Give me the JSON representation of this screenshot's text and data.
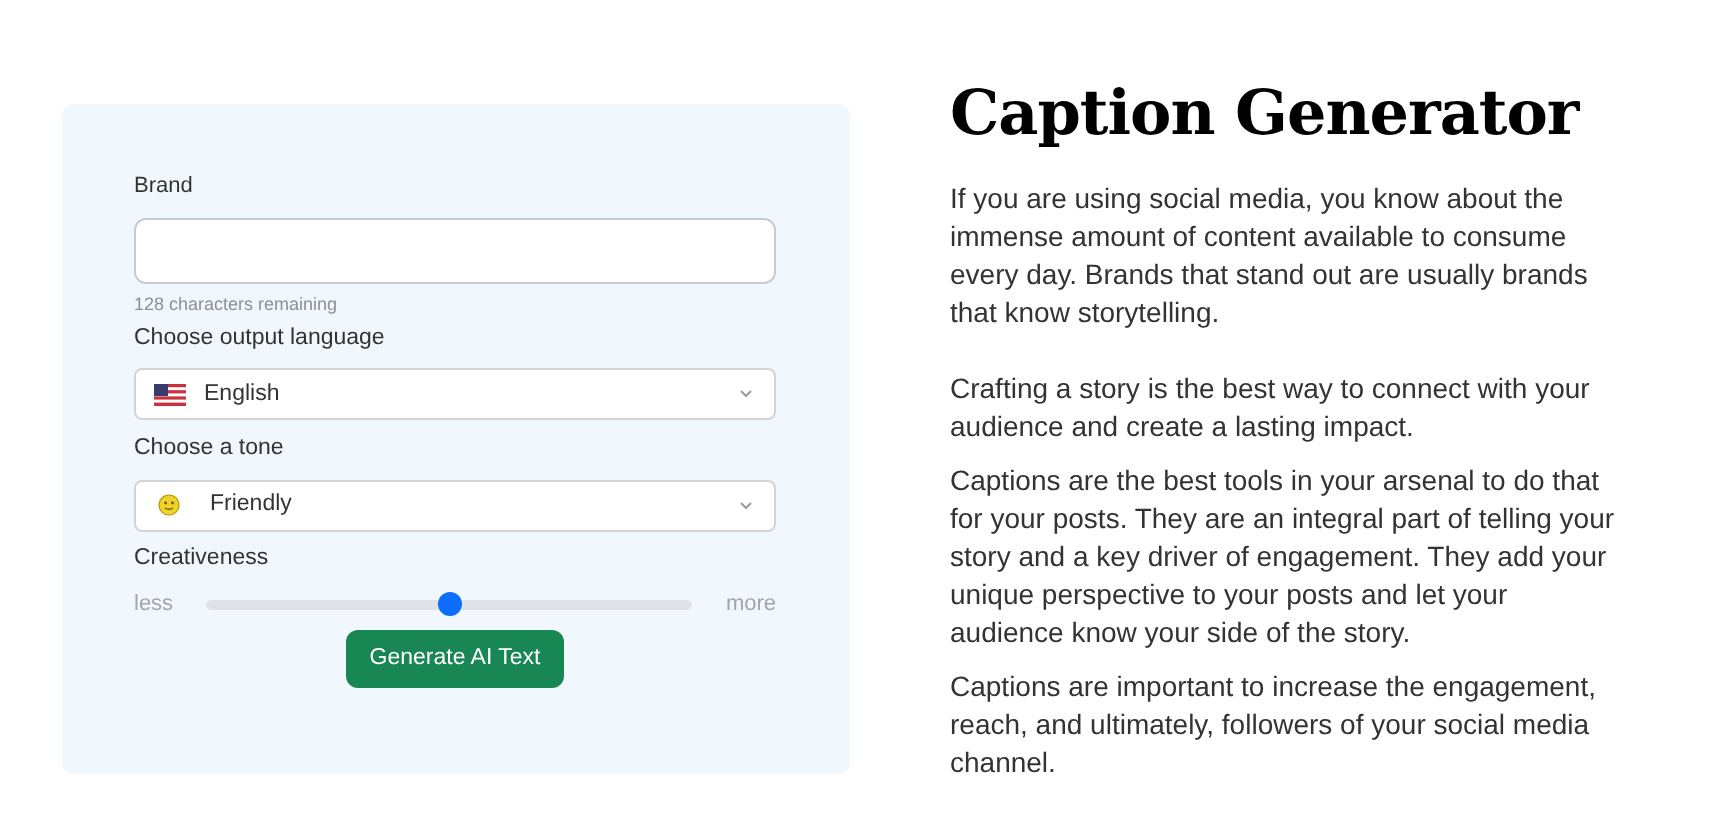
{
  "form": {
    "brand": {
      "label": "Brand",
      "hint": "128 characters remaining"
    },
    "language": {
      "label": "Choose output language",
      "value": "English"
    },
    "tone": {
      "label": "Choose a tone",
      "value": "Friendly"
    },
    "creativeness": {
      "label": "Creativeness",
      "min_label": "less",
      "max_label": "more",
      "level": 0.5
    },
    "button": "Generate AI Text"
  },
  "article": {
    "title": "Caption Generator",
    "paragraphs": [
      "If you are using social media, you know about the immense amount of content available to consume every day. Brands that stand out are usually brands that know storytelling.",
      "Crafting a story is the best way to connect with your audience and create a lasting impact.",
      "Captions are the best tools in your arsenal to do that for your posts. They are an integral part of telling your story and a key driver of engagement. They add your unique perspective to your posts and let your audience know your side of the story.",
      "Captions are important to increase the engagement, reach, and ultimately, followers of your social media channel."
    ]
  }
}
